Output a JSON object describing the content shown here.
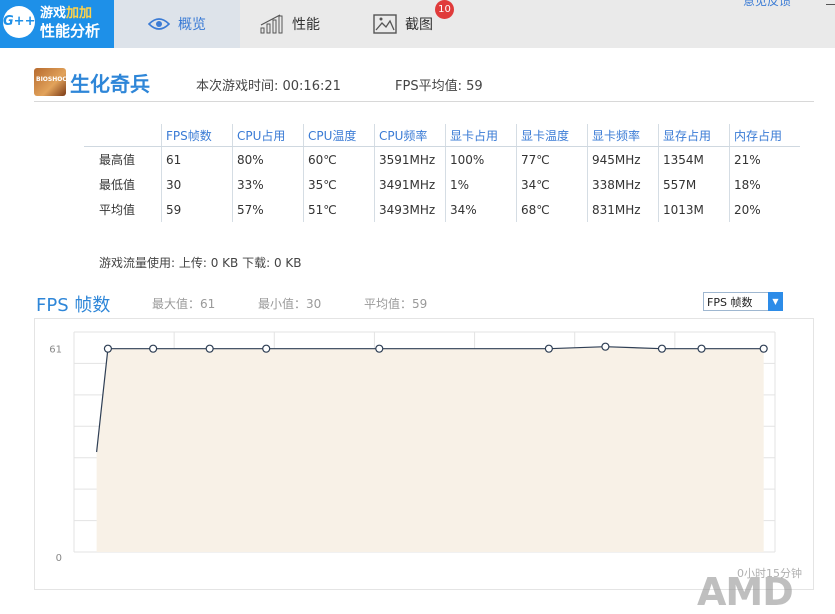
{
  "app": {
    "logo_badge": "G++",
    "logo_line1_a": "游戏",
    "logo_line1_b": "加加",
    "logo_line2": "性能分析"
  },
  "tabs": [
    {
      "label": "概览",
      "icon": "eye-icon",
      "active": true
    },
    {
      "label": "性能",
      "icon": "bar-chart-icon",
      "active": false
    },
    {
      "label": "截图",
      "icon": "screenshot-icon",
      "active": false,
      "badge": "10"
    }
  ],
  "header": {
    "feedback": "意见反馈"
  },
  "game": {
    "icon_text": "BIOSHOCK",
    "name": "生化奇兵",
    "play_time": "本次游戏时间: 00:16:21",
    "fps_avg": "FPS平均值: 59"
  },
  "stats": {
    "columns": [
      "FPS帧数",
      "CPU占用",
      "CPU温度",
      "CPU频率",
      "显卡占用",
      "显卡温度",
      "显卡频率",
      "显存占用",
      "内存占用"
    ],
    "rows": [
      {
        "label": "最高值",
        "values": [
          "61",
          "80%",
          "60℃",
          "3591MHz",
          "100%",
          "77℃",
          "945MHz",
          "1354M",
          "21%"
        ]
      },
      {
        "label": "最低值",
        "values": [
          "30",
          "33%",
          "35℃",
          "3491MHz",
          "1%",
          "34℃",
          "338MHz",
          "557M",
          "18%"
        ]
      },
      {
        "label": "平均值",
        "values": [
          "59",
          "57%",
          "51℃",
          "3493MHz",
          "34%",
          "68℃",
          "831MHz",
          "1013M",
          "20%"
        ]
      }
    ]
  },
  "traffic": "游戏流量使用: 上传: 0 KB    下载: 0 KB",
  "chart_header": {
    "title": "FPS 帧数",
    "max": "最大值：61",
    "min": "最小值：30",
    "avg": "平均值：59",
    "select_value": "FPS 帧数"
  },
  "chart_data": {
    "type": "line",
    "x": [
      0,
      0.2,
      1,
      2,
      3,
      5,
      8,
      9,
      10,
      10.7,
      11.8
    ],
    "values": [
      30,
      61,
      61,
      61,
      61,
      61,
      61,
      61.6,
      61,
      61,
      61
    ],
    "marked": [
      false,
      true,
      true,
      true,
      true,
      true,
      true,
      true,
      true,
      true,
      true
    ],
    "y_ticks": [
      "61",
      "0"
    ],
    "ylim": [
      0,
      66
    ],
    "xlim": [
      -0.4,
      12
    ],
    "grid": true,
    "line_color": "#2f3f55",
    "fill_color": "#f8f1e7",
    "duration_label": "0小时15分钟"
  },
  "watermark": "AMD"
}
